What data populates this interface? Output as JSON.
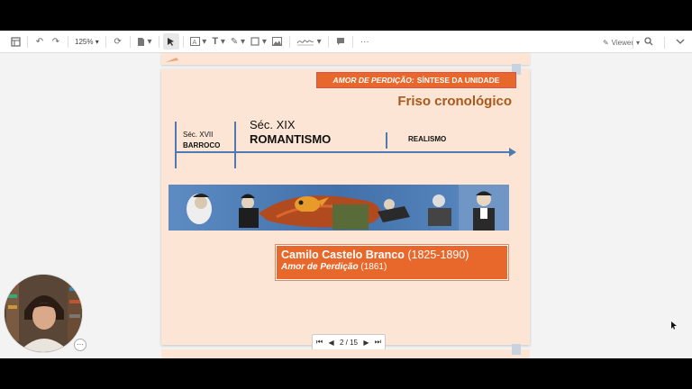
{
  "toolbar": {
    "zoom": "125%",
    "viewer_label": "Viewer"
  },
  "slide": {
    "banner_italic": "AMOR DE PERDIÇÃO:",
    "banner_rest": "SÍNTESE DA UNIDADE",
    "title": "Friso cronológico",
    "timeline": {
      "sec17": "Séc. XVII",
      "barroco": "BARROCO",
      "sec19": "Séc. XIX",
      "romantismo": "ROMANTISMO",
      "realismo": "REALISMO"
    },
    "author": {
      "name": "Camilo Castelo Branco",
      "years": "(1825-1890)",
      "work": "Amor de Perdição",
      "work_year": "(1861)"
    }
  },
  "pager": {
    "text": "2 / 15"
  },
  "colors": {
    "slide_bg": "#fce5d4",
    "accent_orange": "#e8682b",
    "title_brown": "#a8591b",
    "timeline_blue": "#4e7ab3"
  }
}
